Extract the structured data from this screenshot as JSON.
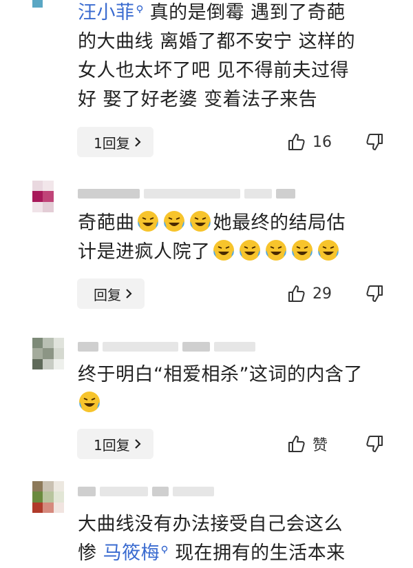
{
  "comments": [
    {
      "username": "汪小菲",
      "text": "真的是倒霉 遇到了奇葩的大曲线 离婚了都不安宁 这样的女人也太坏了吧 见不得前夫过得好 娶了好老婆 变着法子来告",
      "line1": "真的是倒霉 遇到了奇葩",
      "line2": "的大曲线 离婚了都不安宁 这样的",
      "line3": "女人也太坏了吧 见不得前夫过得",
      "line4": "好 娶了好老婆 变着法子来告",
      "reply_label": "1回复",
      "like_count": "16"
    },
    {
      "text_part1": "奇葩曲",
      "text_part2": "她最终的结局估",
      "text_part3": "计是进疯人院了",
      "emoji": "laughing-crying-emoji",
      "reply_label": "回复",
      "like_count": "29"
    },
    {
      "text": "终于明白“相爱相杀”这词的内含了",
      "emoji": "laughing-crying-emoji",
      "reply_label": "1回复",
      "like_label": "赞"
    },
    {
      "line1": "大曲线没有办法接受自己会这么",
      "line2_part1": "惨",
      "line2_part2": "马筱梅",
      "line2_part3": "现在拥有的生活本来"
    }
  ],
  "colors": {
    "username": "#3a6bd0",
    "text": "#222222",
    "button_bg": "#f2f2f2",
    "icon": "#333333"
  }
}
